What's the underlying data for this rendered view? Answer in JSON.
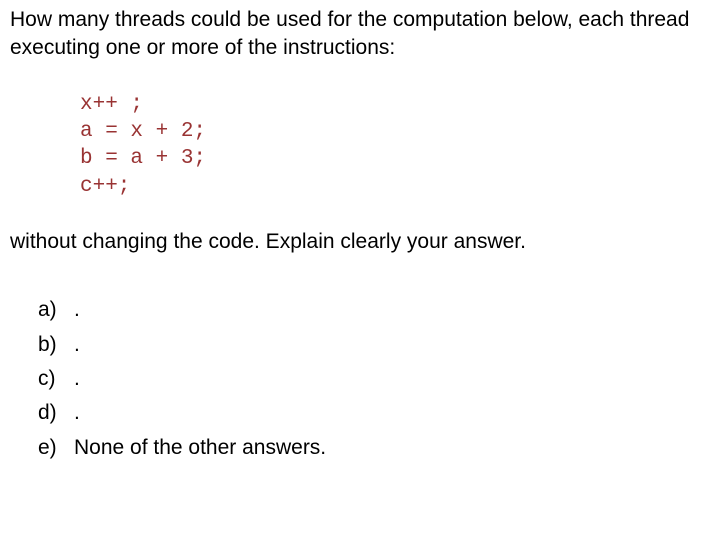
{
  "question": {
    "intro": "How many threads could be used for the computation below, each thread executing one or more of the instructions:",
    "outro": "without changing the code. Explain clearly your answer."
  },
  "code": {
    "line1": "x++ ;",
    "line2": "a = x + 2;",
    "line3": "b = a + 3;",
    "line4": "c++;"
  },
  "options": {
    "a": {
      "label": "a)",
      "text": "."
    },
    "b": {
      "label": "b)",
      "text": "."
    },
    "c": {
      "label": "c)",
      "text": "."
    },
    "d": {
      "label": "d)",
      "text": "."
    },
    "e": {
      "label": "e)",
      "text": "None of the other answers."
    }
  }
}
